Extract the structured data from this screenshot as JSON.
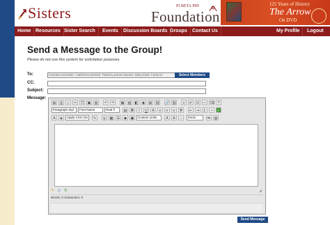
{
  "header": {
    "logo_text": "Sisters",
    "pi_beta_phi": "PI BETA PHI",
    "foundation_text": "Foundation",
    "banner": {
      "years": "125 Years of History",
      "title": "The Arrow",
      "dvd": "On DVD"
    }
  },
  "nav": {
    "items": [
      {
        "label": "Home"
      },
      {
        "label": "Resources"
      },
      {
        "label": "Sister Search"
      },
      {
        "label": "Events"
      },
      {
        "label": "Discussion Boards"
      },
      {
        "label": "Groups"
      },
      {
        "label": "Contact Us"
      }
    ],
    "right_items": [
      {
        "label": "My Profile"
      },
      {
        "label": "Logout"
      }
    ]
  },
  "main": {
    "title": "Send a Message to the Group!",
    "note": "Please do not use this system for solicitation purposes.",
    "form": {
      "to_label": "To:",
      "to_value": "Candace,Dressler; Catherine,McNish; Patricia,James-Davies; Mary,Klatt; Carla,Or",
      "select_members_label": "Select Members",
      "cc_label": "CC:",
      "cc_value": "",
      "subject_label": "Subject:",
      "subject_value": "",
      "message_label": "Message:"
    },
    "editor": {
      "paragraph_style": "Paragraph Styl",
      "font_name": "Font Name",
      "font_size": "Real fi",
      "apply_css": "Apply CSS Cla",
      "custom_links": "Custom Links",
      "zoom": "Zoom",
      "stats": "Words: 0  Characters: 0"
    },
    "send_label": "Send Message"
  }
}
